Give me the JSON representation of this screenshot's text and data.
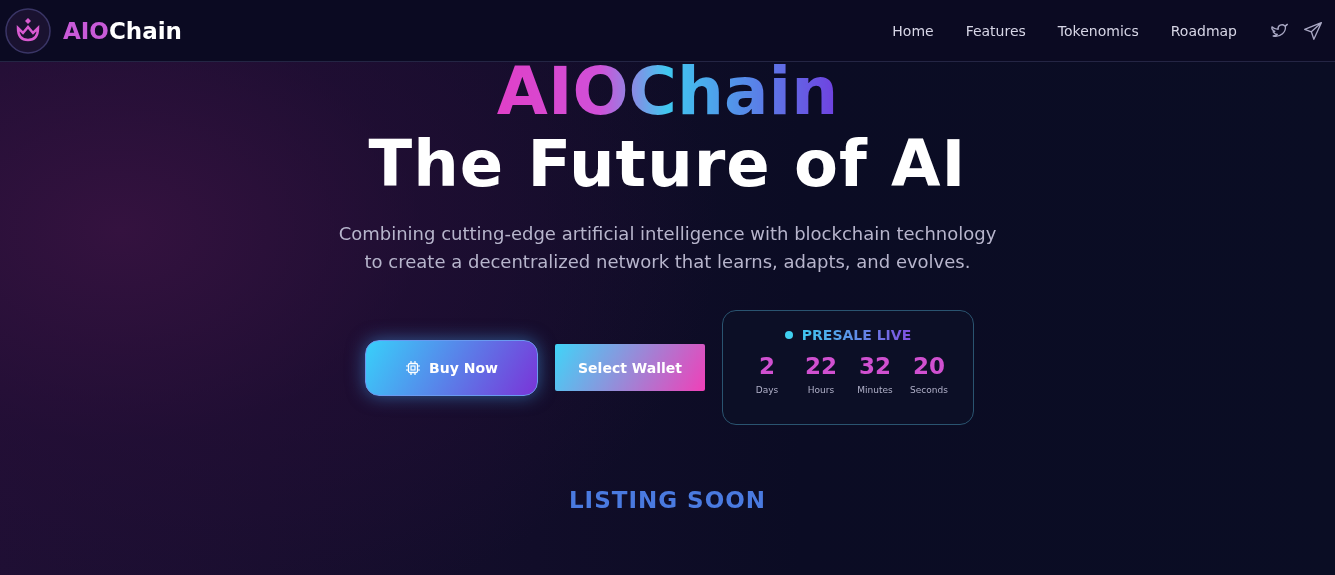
{
  "brand": {
    "prefix": "AIO",
    "suffix": "Chain"
  },
  "nav": [
    {
      "label": "Home"
    },
    {
      "label": "Features"
    },
    {
      "label": "Tokenomics"
    },
    {
      "label": "Roadmap"
    }
  ],
  "social": [
    {
      "kind": "twitter"
    },
    {
      "kind": "telegram"
    }
  ],
  "hero": {
    "brand": "AIOChain",
    "title": "The Future of AI",
    "subtitle": "Combining cutting-edge artificial intelligence with blockchain technology to create a decentralized network that learns, adapts, and evolves."
  },
  "buttons": [
    {
      "label": "Buy Now",
      "kind": "primary"
    },
    {
      "label": "Select Wallet",
      "kind": "secondary"
    }
  ],
  "presale": {
    "status": "PRESALE LIVE",
    "countdown": [
      {
        "value": "2",
        "unit": "Days"
      },
      {
        "value": "22",
        "unit": "Hours"
      },
      {
        "value": "32",
        "unit": "Minutes"
      },
      {
        "value": "20",
        "unit": "Seconds"
      }
    ]
  },
  "listing": "LISTING SOON"
}
